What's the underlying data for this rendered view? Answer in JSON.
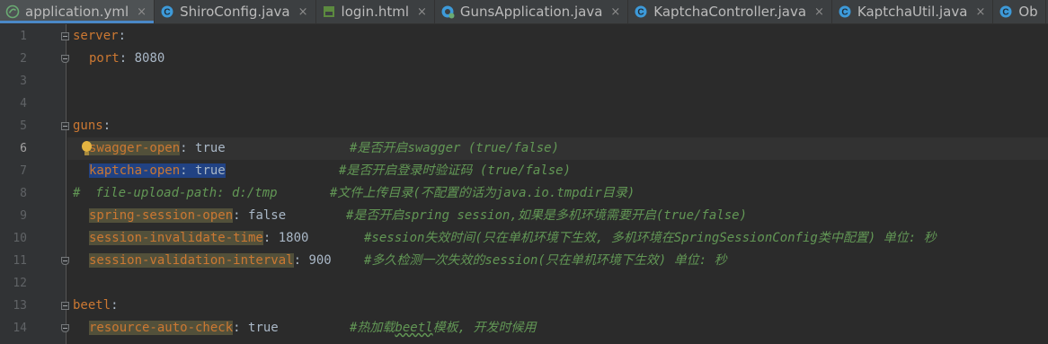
{
  "tabs": [
    {
      "name": "application.yml",
      "icon": "yml-file-icon",
      "active": true
    },
    {
      "name": "ShiroConfig.java",
      "icon": "java-class-icon",
      "active": false
    },
    {
      "name": "login.html",
      "icon": "html-file-icon",
      "active": false
    },
    {
      "name": "GunsApplication.java",
      "icon": "spring-boot-class-icon",
      "active": false
    },
    {
      "name": "KaptchaController.java",
      "icon": "java-class-icon",
      "active": false
    },
    {
      "name": "KaptchaUtil.java",
      "icon": "java-class-icon",
      "active": false
    },
    {
      "name": "Ob",
      "icon": "java-class-icon",
      "active": false
    }
  ],
  "tab_close_glyph": "×",
  "editor": {
    "current_line": "6",
    "lines": [
      {
        "num": "1",
        "key": "server",
        "colon": ":"
      },
      {
        "num": "2",
        "key": "port",
        "colon": ":",
        "value": " 8080"
      },
      {
        "num": "3"
      },
      {
        "num": "4"
      },
      {
        "num": "5",
        "key": "guns",
        "colon": ":"
      },
      {
        "num": "6",
        "key": "swagger-open",
        "colon": ":",
        "value": " true",
        "comment": "#是否开启swagger (true/false)"
      },
      {
        "num": "7",
        "key": "kaptcha-open",
        "colon": ":",
        "value": " true",
        "comment": "#是否开启登录时验证码 (true/false)"
      },
      {
        "num": "8",
        "comment": "#  file-upload-path: d:/tmp",
        "comment2": "#文件上传目录(不配置的话为java.io.tmpdir目录)"
      },
      {
        "num": "9",
        "key": "spring-session-open",
        "colon": ":",
        "value": " false",
        "comment": "#是否开启spring session,如果是多机环境需要开启(true/false)"
      },
      {
        "num": "10",
        "key": "session-invalidate-time",
        "colon": ":",
        "value": " 1800",
        "comment": "#session失效时间(只在单机环境下生效, 多机环境在SpringSessionConfig类中配置) 单位: 秒"
      },
      {
        "num": "11",
        "key": "session-validation-interval",
        "colon": ":",
        "value": " 900",
        "comment": "#多久检测一次失效的session(只在单机环境下生效) 单位: 秒"
      },
      {
        "num": "12"
      },
      {
        "num": "13",
        "key": "beetl",
        "colon": ":"
      },
      {
        "num": "14",
        "key": "resource-auto-check",
        "colon": ":",
        "value": " true",
        "comment_pre": "#热加载",
        "comment_word": "beetl",
        "comment_post": "模板, 开发时候用"
      }
    ]
  },
  "gutter_numbers": [
    "1",
    "2",
    "3",
    "4",
    "5",
    "6",
    "7",
    "8",
    "9",
    "10",
    "11",
    "12",
    "13",
    "14"
  ],
  "colors": {
    "background": "#2b2b2b",
    "gutter": "#313335",
    "key": "#cc7832",
    "comment": "#629755",
    "text": "#a9b7c6",
    "selection": "#214283",
    "highlight": "#52503a",
    "tab_accent": "#4a88c7"
  }
}
